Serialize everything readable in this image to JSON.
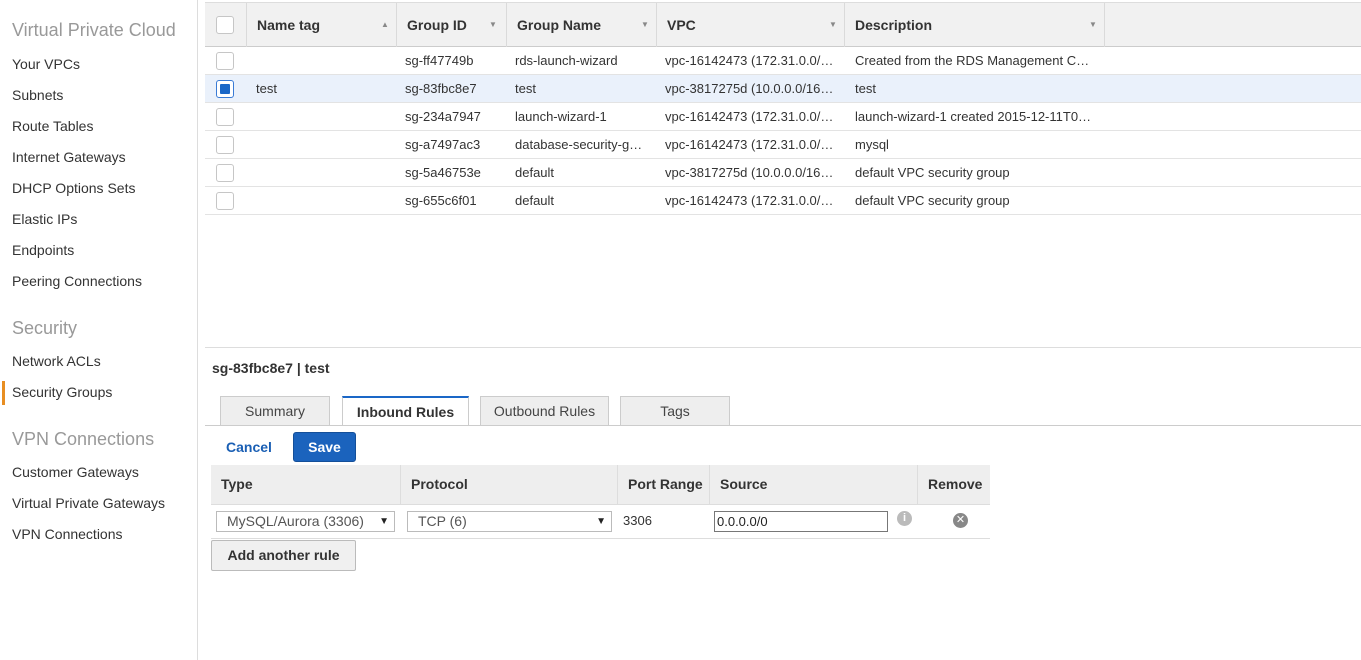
{
  "sidebar": {
    "sections": [
      {
        "heading": "Virtual Private Cloud",
        "items": [
          "Your VPCs",
          "Subnets",
          "Route Tables",
          "Internet Gateways",
          "DHCP Options Sets",
          "Elastic IPs",
          "Endpoints",
          "Peering Connections"
        ]
      },
      {
        "heading": "Security",
        "items": [
          "Network ACLs",
          "Security Groups"
        ]
      },
      {
        "heading": "VPN Connections",
        "items": [
          "Customer Gateways",
          "Virtual Private Gateways",
          "VPN Connections"
        ]
      }
    ],
    "active_item": "Security Groups",
    "accent_color": "#e88e22"
  },
  "table": {
    "columns": [
      "Name tag",
      "Group ID",
      "Group Name",
      "VPC",
      "Description"
    ],
    "sort_column": "Name tag",
    "rows": [
      {
        "name_tag": "",
        "group_id": "sg-ff47749b",
        "group_name": "rds-launch-wizard",
        "vpc": "vpc-16142473 (172.31.0.0/…",
        "description": "Created from the RDS Management C…",
        "selected": false
      },
      {
        "name_tag": "test",
        "group_id": "sg-83fbc8e7",
        "group_name": "test",
        "vpc": "vpc-3817275d (10.0.0.0/16…",
        "description": "test",
        "selected": true
      },
      {
        "name_tag": "",
        "group_id": "sg-234a7947",
        "group_name": "launch-wizard-1",
        "vpc": "vpc-16142473 (172.31.0.0/…",
        "description": "launch-wizard-1 created 2015-12-11T0…",
        "selected": false
      },
      {
        "name_tag": "",
        "group_id": "sg-a7497ac3",
        "group_name": "database-security-g…",
        "vpc": "vpc-16142473 (172.31.0.0/…",
        "description": "mysql",
        "selected": false
      },
      {
        "name_tag": "",
        "group_id": "sg-5a46753e",
        "group_name": "default",
        "vpc": "vpc-3817275d (10.0.0.0/16…",
        "description": "default VPC security group",
        "selected": false
      },
      {
        "name_tag": "",
        "group_id": "sg-655c6f01",
        "group_name": "default",
        "vpc": "vpc-16142473 (172.31.0.0/…",
        "description": "default VPC security group",
        "selected": false
      }
    ]
  },
  "detail": {
    "title": "sg-83fbc8e7 | test",
    "tabs": [
      "Summary",
      "Inbound Rules",
      "Outbound Rules",
      "Tags"
    ],
    "active_tab": "Inbound Rules",
    "cancel_label": "Cancel",
    "save_label": "Save",
    "rule_columns": [
      "Type",
      "Protocol",
      "Port Range",
      "Source",
      "Remove"
    ],
    "rule": {
      "type": "MySQL/Aurora (3306)",
      "protocol": "TCP (6)",
      "port_range": "3306",
      "source": "0.0.0.0/0"
    },
    "add_rule_label": "Add another rule"
  },
  "icons": {
    "sort_up": "▲",
    "sort_down": "▼",
    "select_arrow": "▼",
    "info": "i",
    "remove": "✕"
  },
  "colors": {
    "primary": "#1b63bd",
    "selected_row": "#eaf1fb"
  }
}
